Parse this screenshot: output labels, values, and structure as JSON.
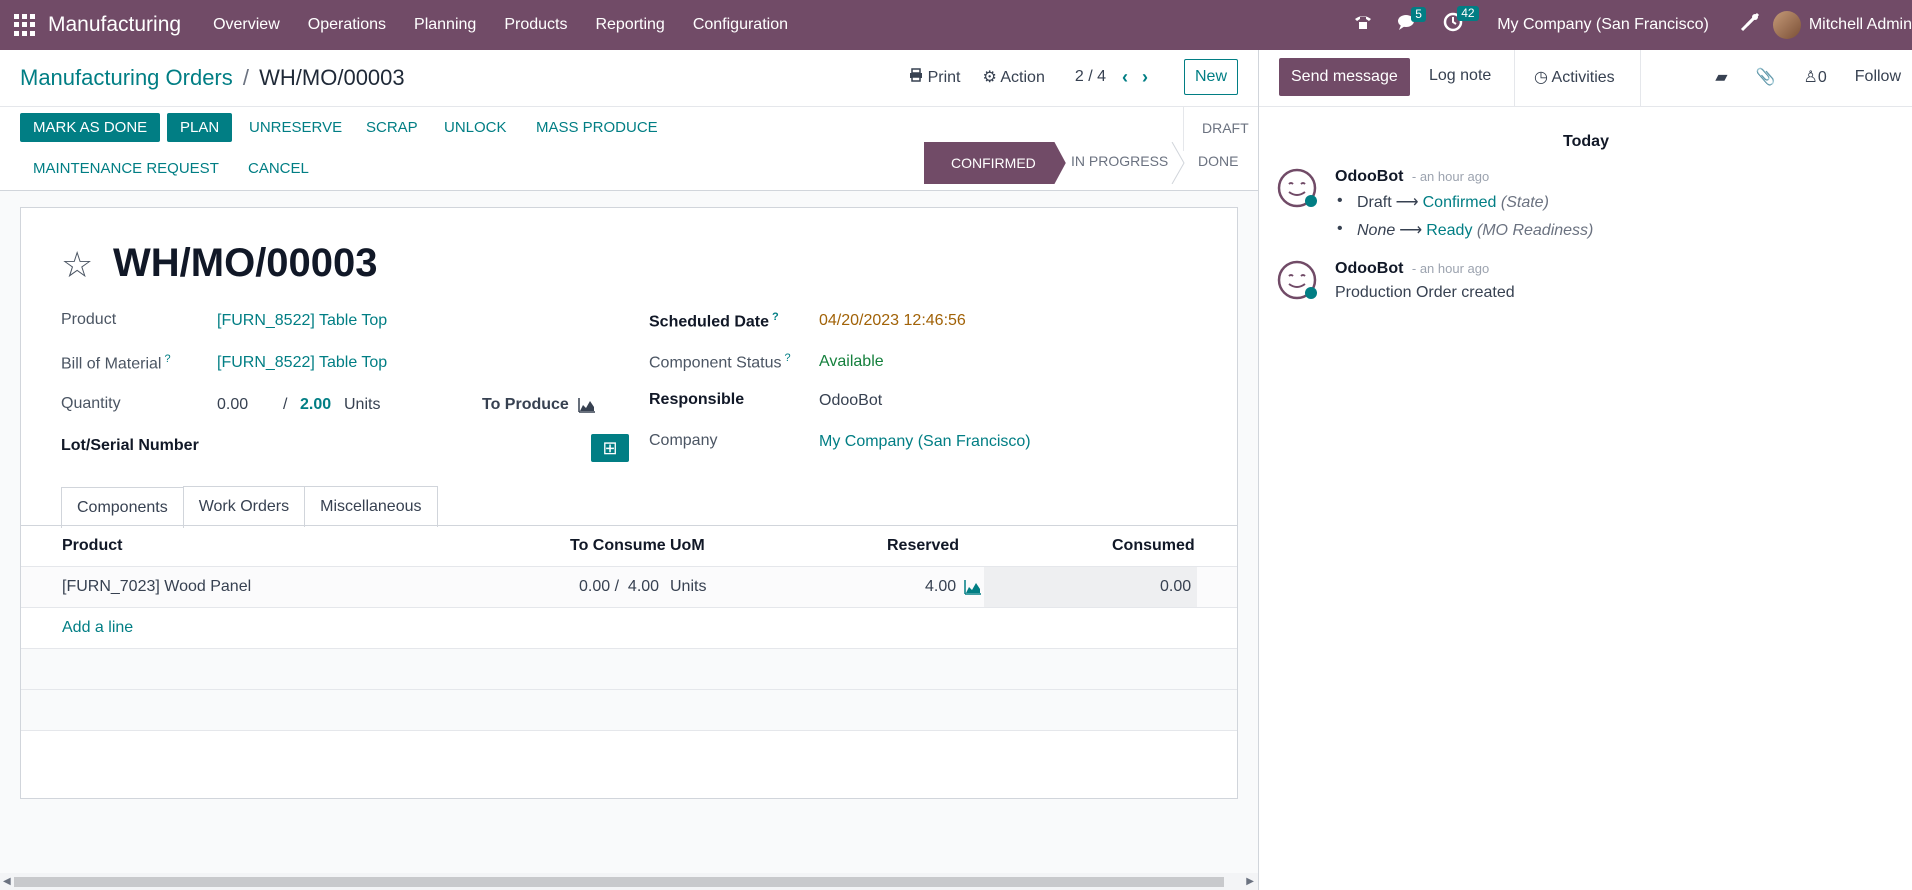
{
  "navbar": {
    "brand": "Manufacturing",
    "menu": [
      "Overview",
      "Operations",
      "Planning",
      "Products",
      "Reporting",
      "Configuration"
    ],
    "messages_count": "5",
    "activities_count": "42",
    "company": "My Company (San Francisco)",
    "user": "Mitchell Admin"
  },
  "control_panel": {
    "breadcrumb_parent": "Manufacturing Orders",
    "breadcrumb_sep": "/",
    "breadcrumb_current": "WH/MO/00003",
    "print_label": "Print",
    "action_label": "Action",
    "pager": "2 / 4",
    "new_label": "New"
  },
  "statusbar": {
    "buttons": [
      "MARK AS DONE",
      "PLAN",
      "UNRESERVE",
      "SCRAP",
      "UNLOCK",
      "MASS PRODUCE",
      "MAINTENANCE REQUEST",
      "CANCEL"
    ],
    "stages": [
      "DRAFT",
      "CONFIRMED",
      "IN PROGRESS",
      "DONE"
    ],
    "active_stage": "CONFIRMED"
  },
  "form": {
    "title": "WH/MO/00003",
    "product_label": "Product",
    "product_value": "[FURN_8522] Table Top",
    "bom_label": "Bill of Material",
    "bom_value": "[FURN_8522] Table Top",
    "quantity_label": "Quantity",
    "qty_produced": "0.00",
    "qty_sep": "/",
    "qty_total": "2.00",
    "qty_uom": "Units",
    "to_produce_label": "To Produce",
    "lot_label": "Lot/Serial Number",
    "scheduled_label": "Scheduled Date",
    "scheduled_value": "04/20/2023 12:46:56",
    "component_status_label": "Component Status",
    "component_status_value": "Available",
    "responsible_label": "Responsible",
    "responsible_value": "OdooBot",
    "company_label": "Company",
    "company_value": "My Company (San Francisco)",
    "help_mark": "?"
  },
  "tabs": [
    "Components",
    "Work Orders",
    "Miscellaneous"
  ],
  "components": {
    "headers": [
      "Product",
      "To Consume",
      "UoM",
      "Reserved",
      "Consumed"
    ],
    "rows": [
      {
        "product": "[FURN_7023] Wood Panel",
        "to_consume": "0.00 /  4.00",
        "uom": "Units",
        "reserved": "4.00",
        "consumed": "0.00"
      }
    ],
    "add_line": "Add a line"
  },
  "chatter": {
    "send_message": "Send message",
    "log_note": "Log note",
    "activities": "Activities",
    "followers_count": "0",
    "follow": "Follow",
    "date_separator": "Today",
    "messages": [
      {
        "author": "OdooBot",
        "time": "- an hour ago",
        "changes": [
          {
            "from": "Draft",
            "to": "Confirmed",
            "field": "(State)"
          },
          {
            "from": "None",
            "to": "Ready",
            "field": "(MO Readiness)"
          }
        ]
      },
      {
        "author": "OdooBot",
        "time": "- an hour ago",
        "body": "Production Order created"
      }
    ]
  },
  "colors": {
    "brand": "#714B67",
    "accent": "#017E84"
  }
}
